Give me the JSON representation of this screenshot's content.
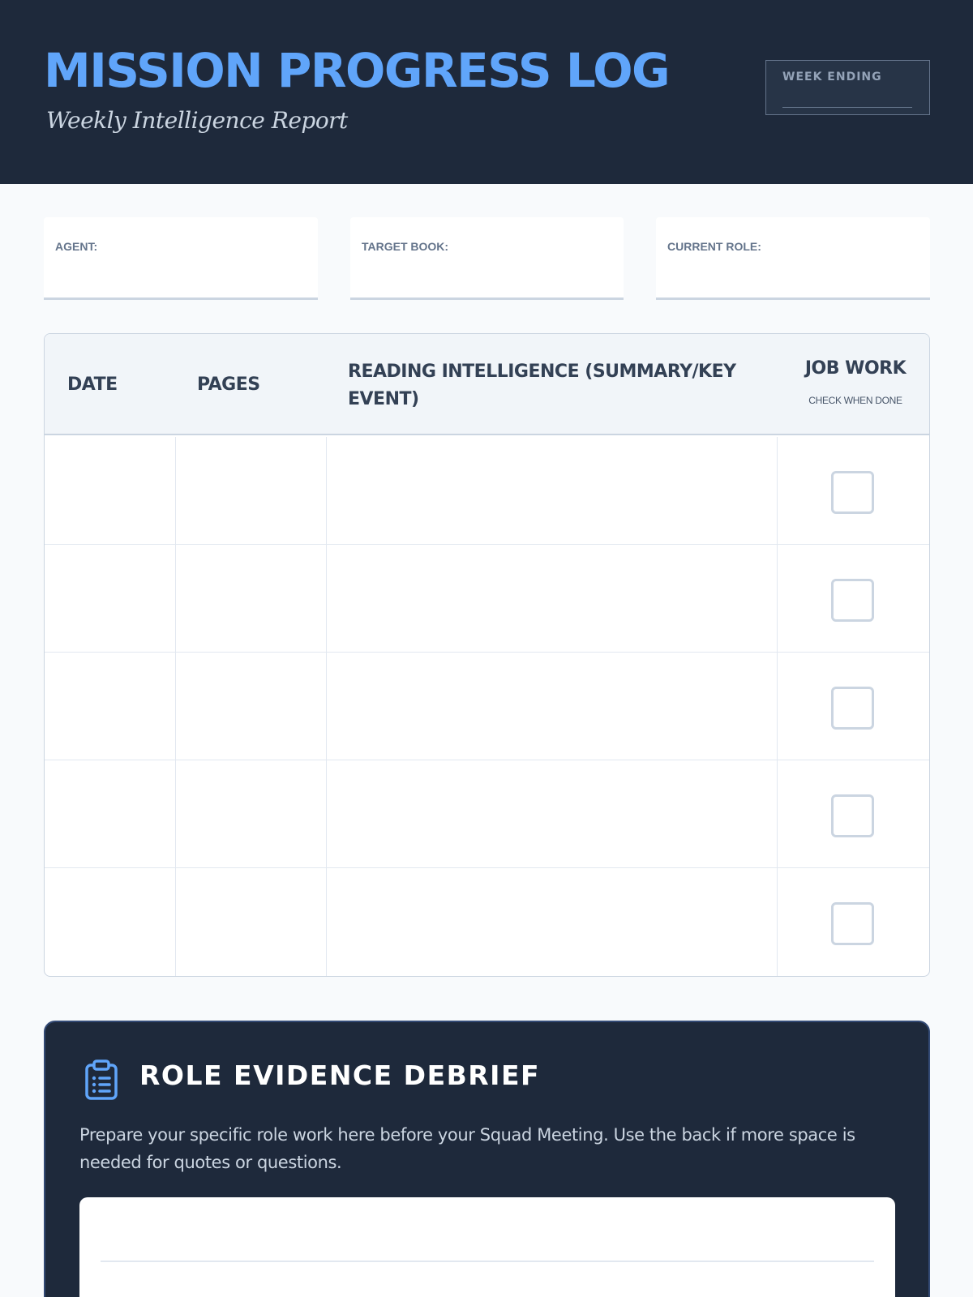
{
  "header": {
    "title": "MISSION PROGRESS LOG",
    "subtitle": "Weekly Intelligence Report",
    "week_ending_label": "WEEK ENDING"
  },
  "fields": {
    "agent_label": "AGENT:",
    "target_book_label": "TARGET BOOK:",
    "current_role_label": "CURRENT ROLE:"
  },
  "table": {
    "columns": {
      "date": "DATE",
      "pages": "PAGES",
      "reading": "READING INTELLIGENCE (SUMMARY/KEY EVENT)",
      "job_work": "JOB WORK",
      "job_work_note": "CHECK WHEN DONE"
    },
    "row_count": 5
  },
  "debrief": {
    "icon": "clipboard-list-icon",
    "title": "ROLE EVIDENCE DEBRIEF",
    "instructions": "Prepare your specific role work here before your Squad Meeting. Use the back if more space is needed for quotes or questions."
  },
  "colors": {
    "header_bg": "#1e293b",
    "accent": "#60a5fa",
    "border": "#cbd5e1"
  }
}
